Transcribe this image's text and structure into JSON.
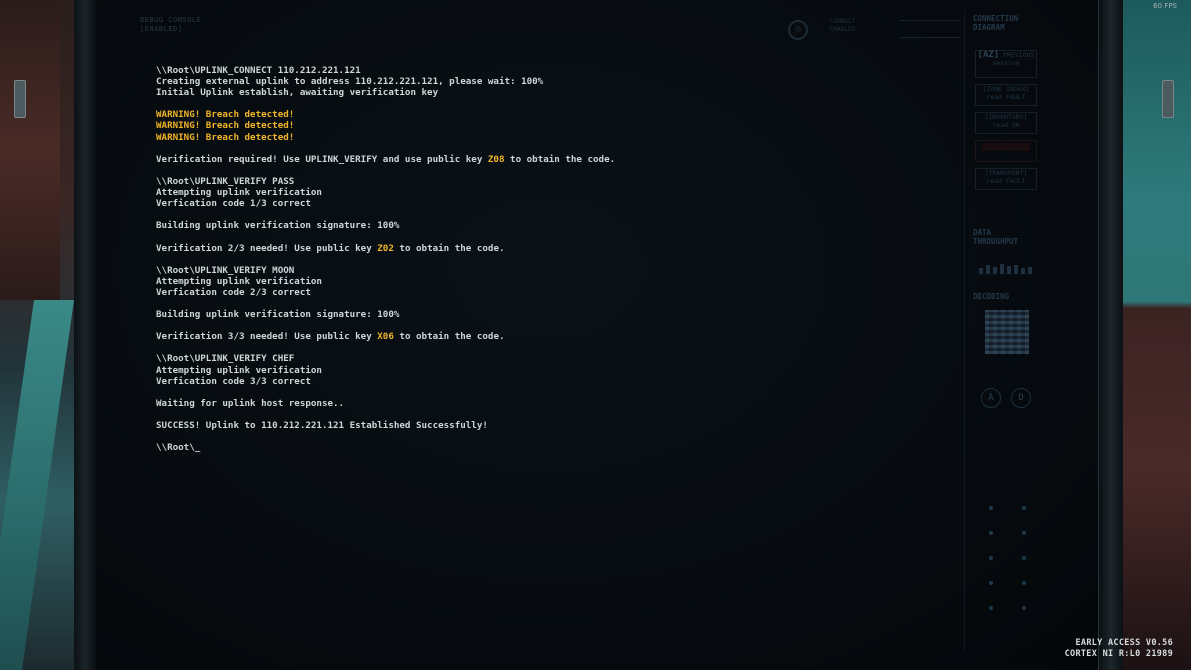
{
  "overlay": {
    "fps": "60 FPS",
    "version_line1": "EARLY ACCESS V0.56",
    "version_line2": "CORTEX NI R:L0 21989"
  },
  "console_header": {
    "title": "DEBUG CONSOLE",
    "state": "[ENABLED]"
  },
  "top_status": {
    "line1": "CONNECT",
    "line2": "ENABLED"
  },
  "terminal": {
    "lines": [
      {
        "type": "text",
        "text": "\\\\Root\\UPLINK_CONNECT 110.212.221.121"
      },
      {
        "type": "text",
        "text": "Creating external uplink to address 110.212.221.121, please wait: 100%"
      },
      {
        "type": "text",
        "text": "Initial Uplink establish, awaiting verification key"
      },
      {
        "type": "blank",
        "text": ""
      },
      {
        "type": "warn",
        "text": "WARNING! Breach detected!"
      },
      {
        "type": "warn",
        "text": "WARNING! Breach detected!"
      },
      {
        "type": "warn",
        "text": "WARNING! Breach detected!"
      },
      {
        "type": "blank",
        "text": ""
      },
      {
        "type": "keyline",
        "pre": "Verification required! Use UPLINK_VERIFY and use public key ",
        "key": "Z08",
        "post": " to obtain the code."
      },
      {
        "type": "blank",
        "text": ""
      },
      {
        "type": "text",
        "text": "\\\\Root\\UPLINK_VERIFY PASS"
      },
      {
        "type": "text",
        "text": "Attempting uplink verification"
      },
      {
        "type": "text",
        "text": "Verfication code 1/3 correct"
      },
      {
        "type": "blank",
        "text": ""
      },
      {
        "type": "text",
        "text": "Building uplink verification signature: 100%"
      },
      {
        "type": "blank",
        "text": ""
      },
      {
        "type": "keyline",
        "pre": "Verification 2/3 needed! Use public key ",
        "key": "Z02",
        "post": " to obtain the code."
      },
      {
        "type": "blank",
        "text": ""
      },
      {
        "type": "text",
        "text": "\\\\Root\\UPLINK_VERIFY MOON"
      },
      {
        "type": "text",
        "text": "Attempting uplink verification"
      },
      {
        "type": "text",
        "text": "Verfication code 2/3 correct"
      },
      {
        "type": "blank",
        "text": ""
      },
      {
        "type": "text",
        "text": "Building uplink verification signature: 100%"
      },
      {
        "type": "blank",
        "text": ""
      },
      {
        "type": "keyline",
        "pre": "Verification 3/3 needed! Use public key ",
        "key": "X06",
        "post": " to obtain the code."
      },
      {
        "type": "blank",
        "text": ""
      },
      {
        "type": "text",
        "text": "\\\\Root\\UPLINK_VERIFY CHEF"
      },
      {
        "type": "text",
        "text": "Attempting uplink verification"
      },
      {
        "type": "text",
        "text": "Verfication code 3/3 correct"
      },
      {
        "type": "blank",
        "text": ""
      },
      {
        "type": "text",
        "text": "Waiting for uplink host response.."
      },
      {
        "type": "blank",
        "text": ""
      },
      {
        "type": "text",
        "text": "SUCCESS! Uplink to 110.212.221.121 Established Successfully!"
      },
      {
        "type": "blank",
        "text": ""
      },
      {
        "type": "prompt",
        "text": "\\\\Root\\_"
      }
    ]
  },
  "side_panel": {
    "connection_title_1": "CONNECTION",
    "connection_title_2": "DIAGRAM",
    "az_label": "[AZ]",
    "az_sub": "PREVIOUS",
    "az_sub2": "session",
    "zone_index": "[ZONE INDEX]",
    "zone_index_state": "read FAULT",
    "inventory": "[INVENTORY]",
    "inventory_state": "read OK",
    "transport": "[TRANSPORT]",
    "transport_state": "read FAULT",
    "data_title_1": "DATA",
    "data_title_2": "THROUGHPUT",
    "decoding": "DECODING",
    "btn_a": "A",
    "btn_d": "D"
  },
  "colors": {
    "terminal_text": "#cfd6d8",
    "warning": "#f0b428",
    "screen_bg": "#05080b"
  }
}
